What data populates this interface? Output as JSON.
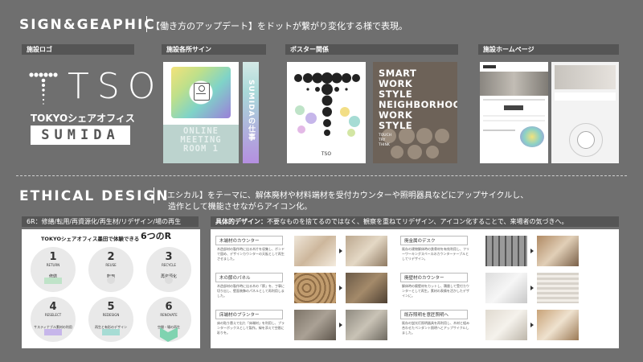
{
  "section1": {
    "title": "SIGN&GEAPHIC",
    "desc": "【働き方のアップデート】をドットが繋がり変化する様で表現。"
  },
  "labels": {
    "logo": "施設ロゴ",
    "sign": "施設各所サイン",
    "poster": "ポスター関係",
    "homepage": "施設ホームページ"
  },
  "logo": {
    "letters": "TSO",
    "sub": "TOKYOシェアオフィス",
    "box": "SUMIDA"
  },
  "sign": {
    "pixel_text": "ONLINE\nMEETING\nROOM 1",
    "vertical_text": "SUMIDAの仕事"
  },
  "poster": {
    "right_text": "SMART\nWORK\nSTYLE\nNEIGHBORHOOD\nWORK\nSTYLE",
    "right_sub": "TOUCH\nTRY\nTHINK"
  },
  "section2": {
    "title": "ETHICAL DESIGN",
    "desc_line1": "【エシカル】をテーマに、解体廃材や材料端材を受付カウンターや照明器具などにアップサイクルし、",
    "desc_line2": "造作として機能させながらアイコン化。"
  },
  "sixr": {
    "label": "6R：修繕/転用/再資源化/再生材/リデザイン/場の再生",
    "heading": "TOKYOシェアオフィス墨田で体験できる",
    "heading_big": "6つのR",
    "items": [
      {
        "num": "1",
        "en": "RETURN",
        "jp": "修繕"
      },
      {
        "num": "2",
        "en": "REUSE",
        "jp": "転用"
      },
      {
        "num": "3",
        "en": "RECYCLE",
        "jp": "再資源化"
      },
      {
        "num": "4",
        "en": "RESELECT",
        "jp": "サスティナブル素材の利用"
      },
      {
        "num": "5",
        "en": "REDESIGN",
        "jp": "再生と有形のデザイン"
      },
      {
        "num": "6",
        "en": "RENOVATE",
        "jp": "空間・場の再生"
      }
    ]
  },
  "design": {
    "label_bold": "具体的デザイン：",
    "label_rest": "不要なものを捨てるのではなく、観察を重ねてリデザイン、アイコン化することで、来場者の気づきへ。",
    "items": [
      {
        "title": "木端材のカウンター",
        "text": "木造部材の製作時に出る木片を収集し、ボンドで固め、デザインカウンターの天板として再生させました。"
      },
      {
        "title": "木の節のパネル",
        "text": "木造部材の製作時に出る木の「節」を、丁寧に切り出し、壁面装飾のパネルとして再利用しました。"
      },
      {
        "title": "床端材のプランター",
        "text": "床の貼り替えで出た「床端材」を利用し、プランターボックスとして製作。緑を添えて空間に彩りを。"
      },
      {
        "title": "廃金属のデスク",
        "text": "既存の建物解体時の鉄骨材を有効利用し、フリーワーキングスペースのカウンターテーブルとしてリデザイン。"
      },
      {
        "title": "廃壁材のカウンター",
        "text": "解体時の廃壁材をカットし、積層して受付カウンターとして再生。素材の表情を活かしたデザインに。"
      },
      {
        "title": "既存照明を意匠照明へ",
        "text": "既存の蛍光灯照明器具を再利用し、木材と組み合わせたペンダント照明へとアップサイクルしました。"
      }
    ]
  }
}
